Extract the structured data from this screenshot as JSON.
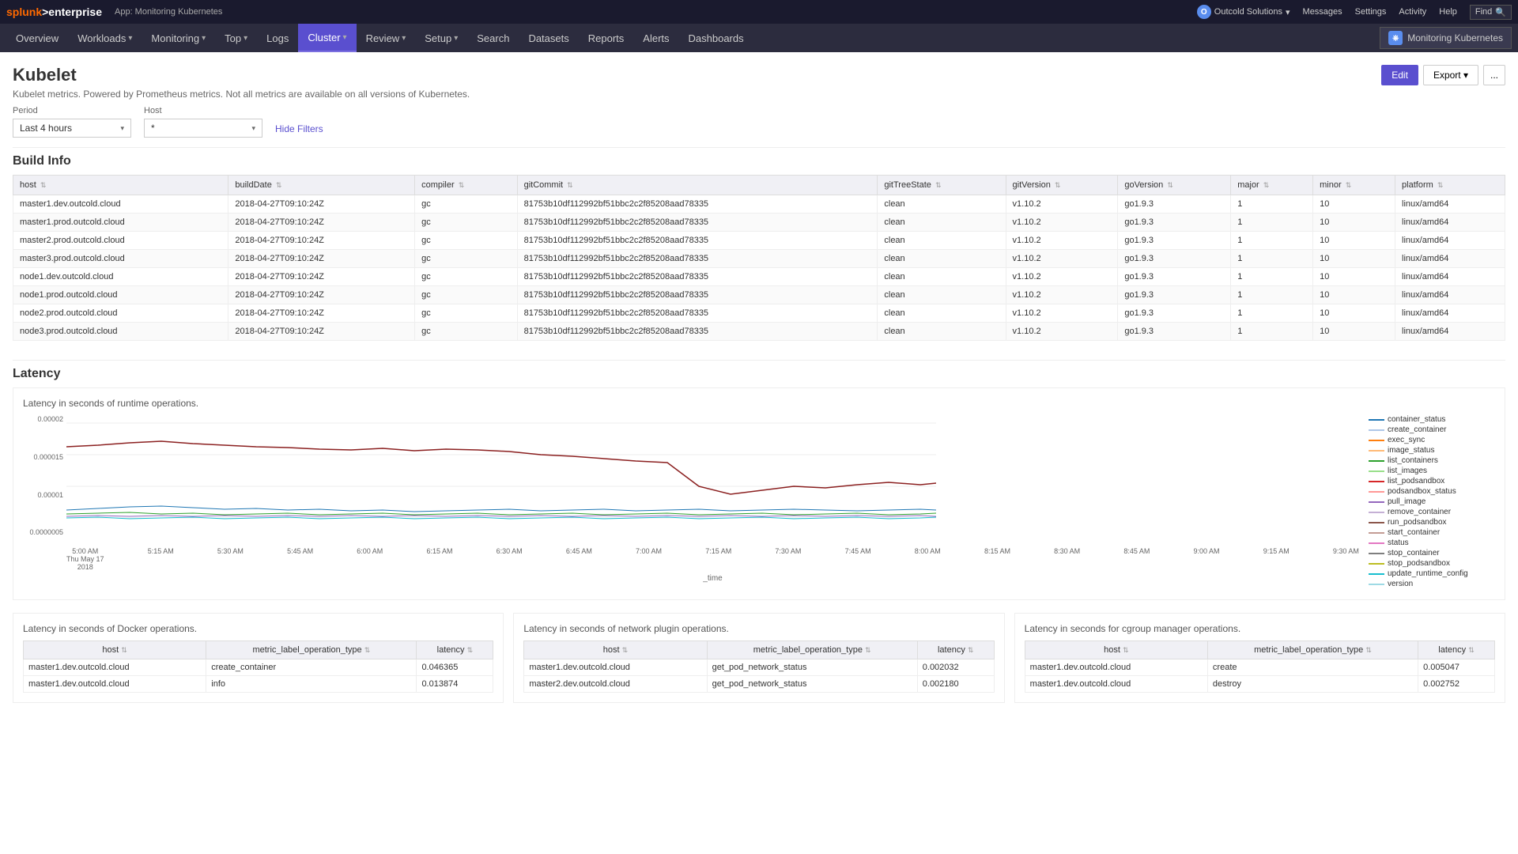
{
  "topbar": {
    "logo": "splunk",
    "logo_suffix": ">enterprise",
    "app_label": "App: Monitoring Kubernetes",
    "user": "O",
    "org": "Outcold Solutions",
    "messages": "Messages",
    "settings": "Settings",
    "activity": "Activity",
    "help": "Help",
    "find_placeholder": "Find"
  },
  "navbar": {
    "items": [
      {
        "label": "Overview",
        "active": false
      },
      {
        "label": "Workloads",
        "has_dropdown": true,
        "active": false
      },
      {
        "label": "Monitoring",
        "has_dropdown": true,
        "active": false
      },
      {
        "label": "Top",
        "has_dropdown": true,
        "active": false
      },
      {
        "label": "Logs",
        "active": false
      },
      {
        "label": "Cluster",
        "has_dropdown": true,
        "active": true
      },
      {
        "label": "Review",
        "has_dropdown": true,
        "active": false
      },
      {
        "label": "Setup",
        "has_dropdown": true,
        "active": false
      },
      {
        "label": "Search",
        "active": false
      },
      {
        "label": "Datasets",
        "active": false
      },
      {
        "label": "Reports",
        "active": false
      },
      {
        "label": "Alerts",
        "active": false
      },
      {
        "label": "Dashboards",
        "active": false
      }
    ],
    "monitoring_k8s": "Monitoring Kubernetes"
  },
  "page": {
    "title": "Kubelet",
    "subtitle": "Kubelet metrics. Powered by Prometheus metrics. Not all metrics are available on all versions of Kubernetes.",
    "edit_label": "Edit",
    "export_label": "Export",
    "more_label": "..."
  },
  "filters": {
    "period_label": "Period",
    "period_value": "Last 4 hours",
    "host_label": "Host",
    "host_value": "*",
    "hide_filters": "Hide Filters"
  },
  "build_info": {
    "section_title": "Build Info",
    "columns": [
      "host",
      "buildDate",
      "compiler",
      "gitCommit",
      "gitTreeState",
      "gitVersion",
      "goVersion",
      "major",
      "minor",
      "platform"
    ],
    "rows": [
      {
        "host": "master1.dev.outcold.cloud",
        "buildDate": "2018-04-27T09:10:24Z",
        "compiler": "gc",
        "gitCommit": "81753b10df112992bf51bbc2c2f85208aad78335",
        "gitTreeState": "clean",
        "gitVersion": "v1.10.2",
        "goVersion": "go1.9.3",
        "major": "1",
        "minor": "10",
        "platform": "linux/amd64"
      },
      {
        "host": "master1.prod.outcold.cloud",
        "buildDate": "2018-04-27T09:10:24Z",
        "compiler": "gc",
        "gitCommit": "81753b10df112992bf51bbc2c2f85208aad78335",
        "gitTreeState": "clean",
        "gitVersion": "v1.10.2",
        "goVersion": "go1.9.3",
        "major": "1",
        "minor": "10",
        "platform": "linux/amd64"
      },
      {
        "host": "master2.prod.outcold.cloud",
        "buildDate": "2018-04-27T09:10:24Z",
        "compiler": "gc",
        "gitCommit": "81753b10df112992bf51bbc2c2f85208aad78335",
        "gitTreeState": "clean",
        "gitVersion": "v1.10.2",
        "goVersion": "go1.9.3",
        "major": "1",
        "minor": "10",
        "platform": "linux/amd64"
      },
      {
        "host": "master3.prod.outcold.cloud",
        "buildDate": "2018-04-27T09:10:24Z",
        "compiler": "gc",
        "gitCommit": "81753b10df112992bf51bbc2c2f85208aad78335",
        "gitTreeState": "clean",
        "gitVersion": "v1.10.2",
        "goVersion": "go1.9.3",
        "major": "1",
        "minor": "10",
        "platform": "linux/amd64"
      },
      {
        "host": "node1.dev.outcold.cloud",
        "buildDate": "2018-04-27T09:10:24Z",
        "compiler": "gc",
        "gitCommit": "81753b10df112992bf51bbc2c2f85208aad78335",
        "gitTreeState": "clean",
        "gitVersion": "v1.10.2",
        "goVersion": "go1.9.3",
        "major": "1",
        "minor": "10",
        "platform": "linux/amd64"
      },
      {
        "host": "node1.prod.outcold.cloud",
        "buildDate": "2018-04-27T09:10:24Z",
        "compiler": "gc",
        "gitCommit": "81753b10df112992bf51bbc2c2f85208aad78335",
        "gitTreeState": "clean",
        "gitVersion": "v1.10.2",
        "goVersion": "go1.9.3",
        "major": "1",
        "minor": "10",
        "platform": "linux/amd64"
      },
      {
        "host": "node2.prod.outcold.cloud",
        "buildDate": "2018-04-27T09:10:24Z",
        "compiler": "gc",
        "gitCommit": "81753b10df112992bf51bbc2c2f85208aad78335",
        "gitTreeState": "clean",
        "gitVersion": "v1.10.2",
        "goVersion": "go1.9.3",
        "major": "1",
        "minor": "10",
        "platform": "linux/amd64"
      },
      {
        "host": "node3.prod.outcold.cloud",
        "buildDate": "2018-04-27T09:10:24Z",
        "compiler": "gc",
        "gitCommit": "81753b10df112992bf51bbc2c2f85208aad78335",
        "gitTreeState": "clean",
        "gitVersion": "v1.10.2",
        "goVersion": "go1.9.3",
        "major": "1",
        "minor": "10",
        "platform": "linux/amd64"
      }
    ]
  },
  "latency": {
    "section_title": "Latency",
    "chart_title": "Latency in seconds of runtime operations.",
    "yaxis_labels": [
      "0.00002",
      "0.000015",
      "0.00001",
      "0.0000005",
      ""
    ],
    "xaxis_labels": [
      "5:00 AM\nThu May 17\n2018",
      "5:15 AM",
      "5:30 AM",
      "5:45 AM",
      "6:00 AM",
      "6:15 AM",
      "6:30 AM",
      "6:45 AM",
      "7:00 AM",
      "7:15 AM",
      "7:30 AM",
      "7:45 AM",
      "8:00 AM",
      "8:15 AM",
      "8:30 AM",
      "8:45 AM",
      "9:00 AM",
      "9:15 AM",
      "9:30 AM"
    ],
    "xlabel": "_time",
    "legend": [
      {
        "label": "container_status",
        "color": "#1f77b4"
      },
      {
        "label": "create_container",
        "color": "#aec7e8"
      },
      {
        "label": "exec_sync",
        "color": "#ff7f0e"
      },
      {
        "label": "image_status",
        "color": "#ffbb78"
      },
      {
        "label": "list_containers",
        "color": "#2ca02c"
      },
      {
        "label": "list_images",
        "color": "#98df8a"
      },
      {
        "label": "list_podsandbox",
        "color": "#d62728"
      },
      {
        "label": "podsandbox_status",
        "color": "#ff9896"
      },
      {
        "label": "pull_image",
        "color": "#9467bd"
      },
      {
        "label": "remove_container",
        "color": "#c5b0d5"
      },
      {
        "label": "run_podsandbox",
        "color": "#8c564b"
      },
      {
        "label": "start_container",
        "color": "#c49c94"
      },
      {
        "label": "status",
        "color": "#e377c2"
      },
      {
        "label": "stop_container",
        "color": "#7f7f7f"
      },
      {
        "label": "stop_podsandbox",
        "color": "#bcbd22"
      },
      {
        "label": "update_runtime_config",
        "color": "#17becf"
      },
      {
        "label": "version",
        "color": "#9edae5"
      }
    ]
  },
  "latency_docker": {
    "title": "Latency in seconds of Docker operations.",
    "columns": [
      "host",
      "metric_label_operation_type",
      "latency"
    ],
    "rows": [
      {
        "host": "master1.dev.outcold.cloud",
        "op": "create_container",
        "latency": "0.046365"
      },
      {
        "host": "master1.dev.outcold.cloud",
        "op": "info",
        "latency": "0.013874"
      }
    ]
  },
  "latency_network": {
    "title": "Latency in seconds of network plugin operations.",
    "columns": [
      "host",
      "metric_label_operation_type",
      "latency"
    ],
    "rows": [
      {
        "host": "master1.dev.outcold.cloud",
        "op": "get_pod_network_status",
        "latency": "0.002032"
      },
      {
        "host": "master2.dev.outcold.cloud",
        "op": "get_pod_network_status",
        "latency": "0.002180"
      }
    ]
  },
  "latency_cgroup": {
    "title": "Latency in seconds for cgroup manager operations.",
    "columns": [
      "host",
      "metric_label_operation_type",
      "latency"
    ],
    "rows": [
      {
        "host": "master1.dev.outcold.cloud",
        "op": "create",
        "latency": "0.005047"
      },
      {
        "host": "master1.dev.outcold.cloud",
        "op": "destroy",
        "latency": "0.002752"
      }
    ]
  }
}
